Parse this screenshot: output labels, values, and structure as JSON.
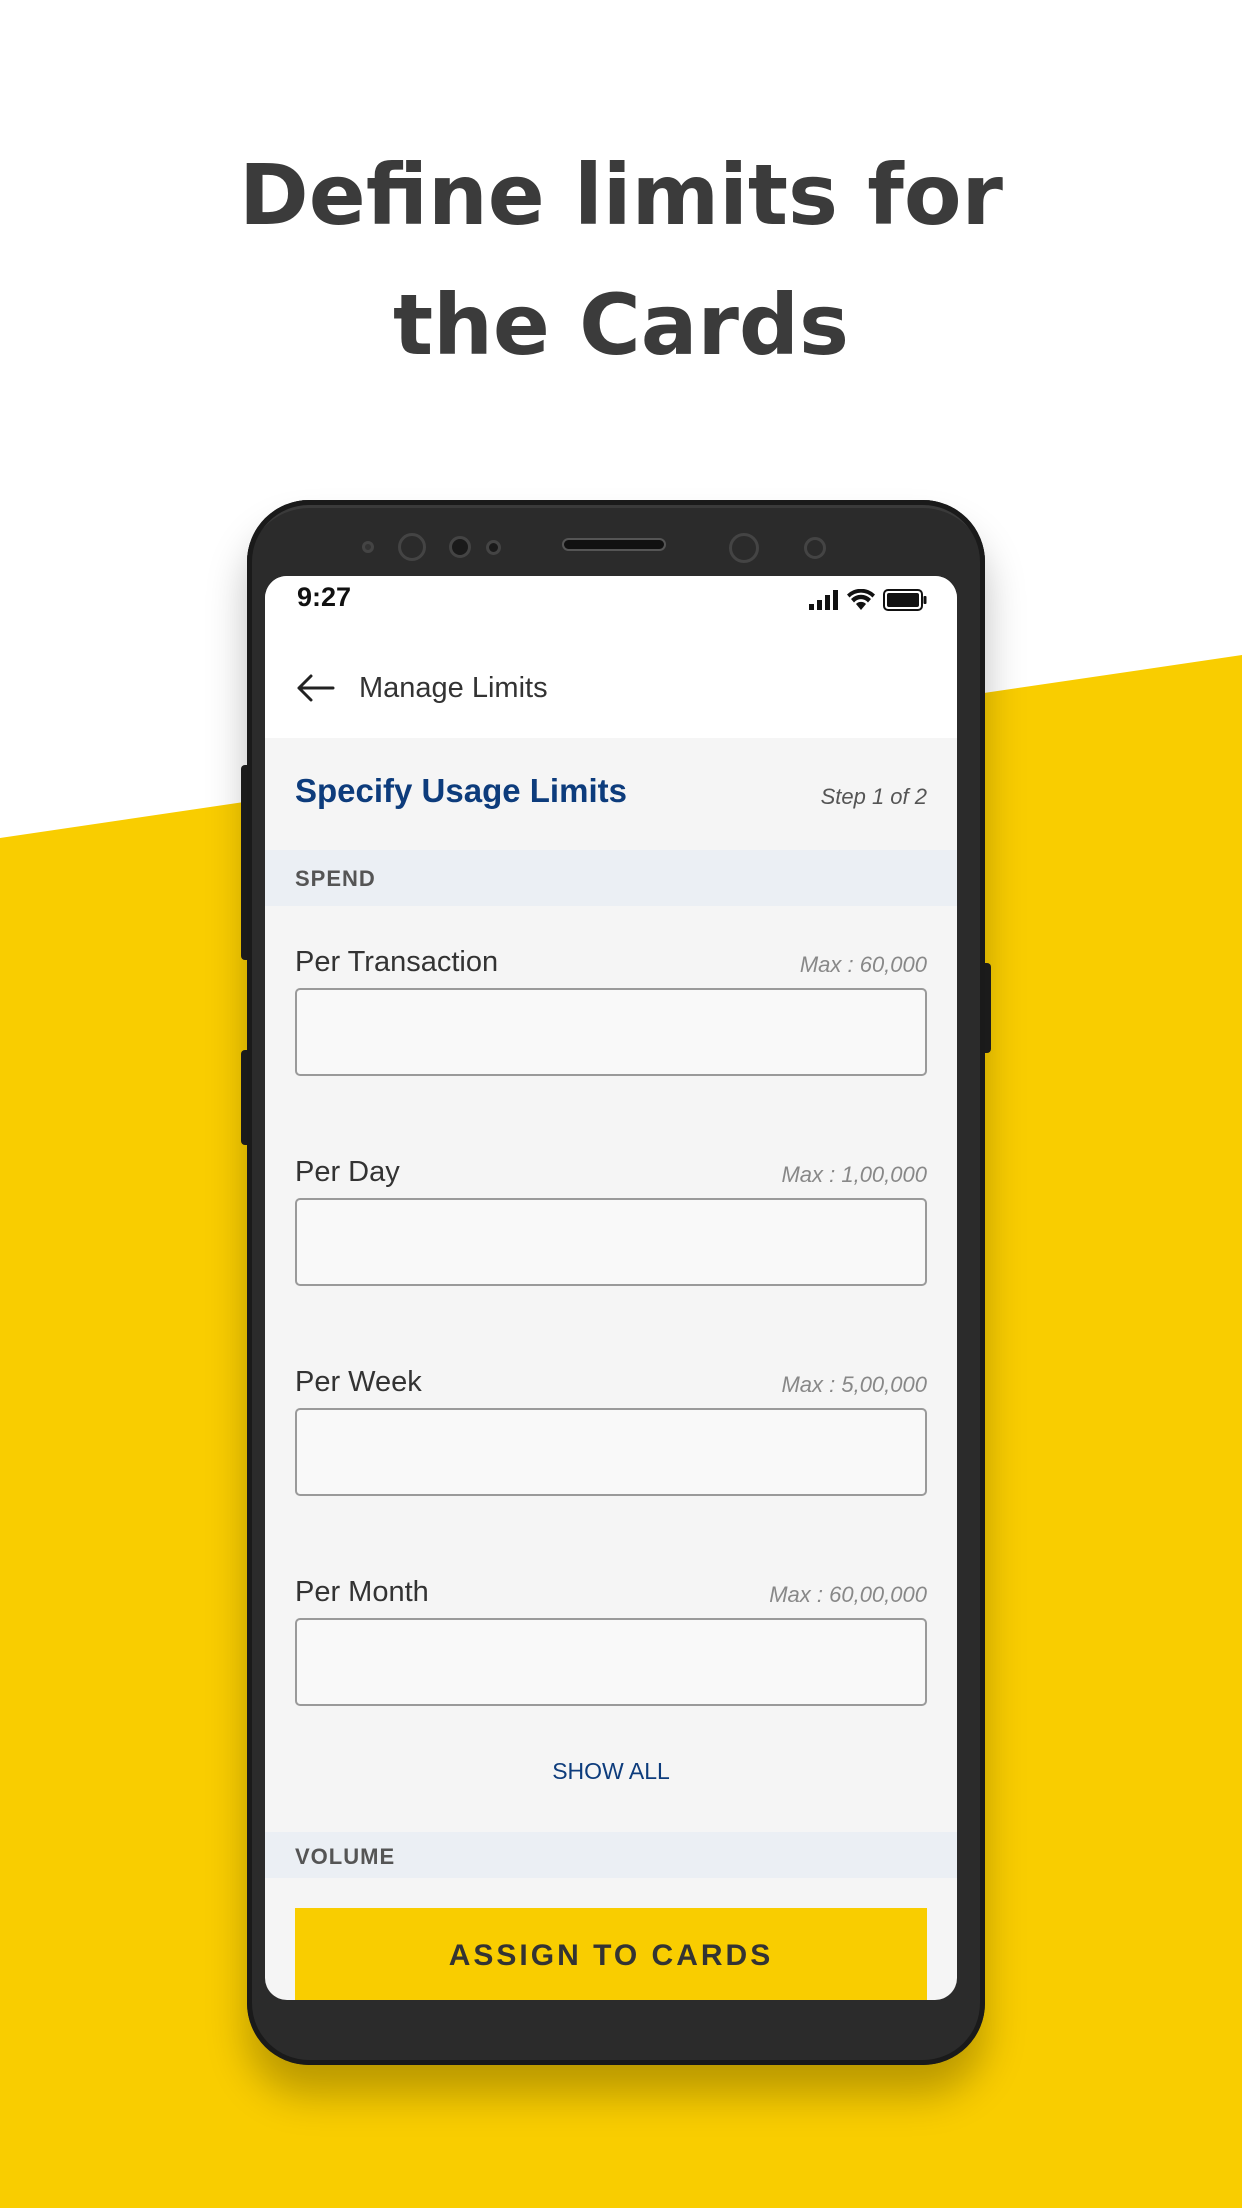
{
  "headline": {
    "line1": "Define limits for",
    "line2": "the Cards"
  },
  "colors": {
    "accent_yellow": "#f9cd00",
    "title_blue": "#0d3c7c",
    "headline_gray": "#3b3b3b"
  },
  "status_bar": {
    "time": "9:27",
    "icons": [
      "signal-icon",
      "wifi-icon",
      "battery-icon"
    ]
  },
  "app_bar": {
    "title": "Manage Limits",
    "back_icon": "arrow-left-icon"
  },
  "section": {
    "title": "Specify Usage Limits",
    "step": "Step 1 of 2"
  },
  "spend_section": {
    "label": "SPEND"
  },
  "fields": [
    {
      "label": "Per Transaction",
      "max": "Max : 60,000",
      "value": "",
      "placeholder": ""
    },
    {
      "label": "Per Day",
      "max": "Max : 1,00,000",
      "value": "",
      "placeholder": ""
    },
    {
      "label": "Per Week",
      "max": "Max : 5,00,000",
      "value": "",
      "placeholder": ""
    },
    {
      "label": "Per Month",
      "max": "Max : 60,00,000",
      "value": "",
      "placeholder": ""
    }
  ],
  "show_all": "SHOW ALL",
  "volume_section": {
    "label": "VOLUME"
  },
  "cta": {
    "label": "ASSIGN TO CARDS"
  }
}
